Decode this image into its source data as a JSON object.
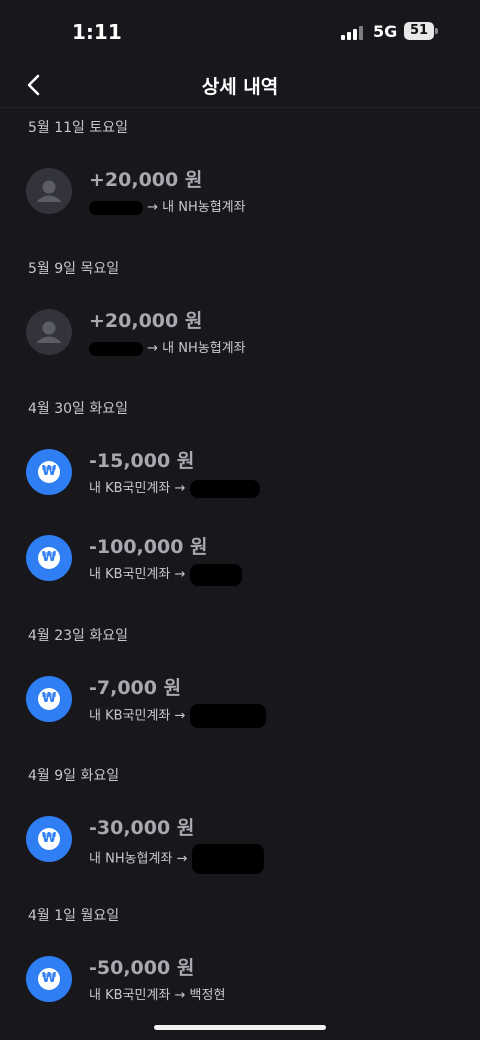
{
  "status_bar": {
    "time": "1:11",
    "network": "5G",
    "battery": "51"
  },
  "header": {
    "title": "상세 내역"
  },
  "transactions": [
    {
      "date": "5월 11일 토요일",
      "amount": "+20,000 원",
      "icon": "person-icon",
      "route_prefix": "",
      "route_suffix": " → 내 NH농협계좌"
    },
    {
      "date": "5월 9일 목요일",
      "amount": "+20,000 원",
      "icon": "person-icon",
      "route_prefix": "",
      "route_suffix": " → 내 NH농협계좌"
    },
    {
      "date": "4월 30일 화요일",
      "amount": "-15,000 원",
      "icon": "won-icon",
      "route_prefix": "내 KB국민계좌 → ",
      "route_suffix": ""
    },
    {
      "date": "",
      "amount": "-100,000 원",
      "icon": "won-icon",
      "route_prefix": "내 KB국민계좌 → ",
      "route_suffix": ""
    },
    {
      "date": "4월 23일 화요일",
      "amount": "-7,000 원",
      "icon": "won-icon",
      "route_prefix": "내 KB국민계좌 → ",
      "route_suffix": ""
    },
    {
      "date": "4월 9일 화요일",
      "amount": "-30,000 원",
      "icon": "won-icon",
      "route_prefix": "내 NH농협계좌 → ",
      "route_suffix": ""
    },
    {
      "date": "4월 1일 월요일",
      "amount": "-50,000 원",
      "icon": "won-icon",
      "route_prefix": "내 KB국민계좌 → 백정현",
      "route_suffix": ""
    }
  ],
  "colors": {
    "background": "#17171c",
    "accent_blue": "#2f7ef3",
    "amount_gray": "#a8a8b0"
  }
}
